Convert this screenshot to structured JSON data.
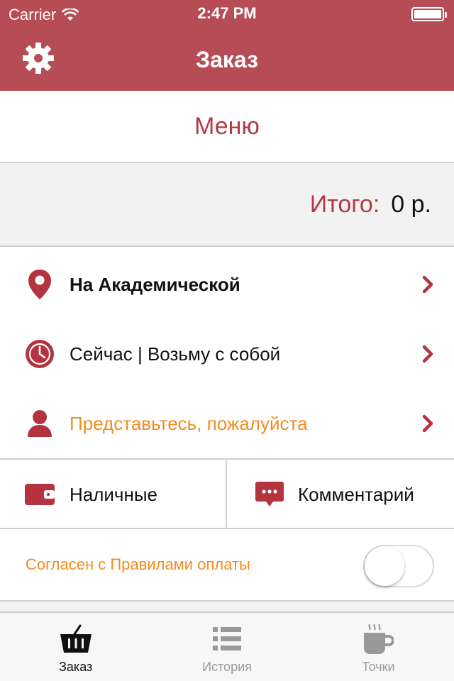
{
  "status_bar": {
    "carrier": "Carrier",
    "time": "2:47 PM"
  },
  "nav": {
    "title": "Заказ",
    "left_icon": "gear-icon"
  },
  "menu": {
    "label": "Меню"
  },
  "total": {
    "label": "Итого:",
    "value": "0 р."
  },
  "info_rows": [
    {
      "icon": "location-pin-icon",
      "text": "На Академической"
    },
    {
      "icon": "clock-icon",
      "text": "Сейчас | Возьму с собой"
    },
    {
      "icon": "person-icon",
      "text": "Представьтесь, пожалуйста"
    }
  ],
  "payment": {
    "icon": "wallet-icon",
    "text": "Наличные"
  },
  "comment": {
    "icon": "chat-bubble-icon",
    "text": "Комментарий"
  },
  "agreement": {
    "text": "Согласен с Правилами оплаты",
    "toggle_on": false
  },
  "tabs": [
    {
      "label": "Заказ",
      "icon": "basket-icon",
      "active": true
    },
    {
      "label": "История",
      "icon": "list-icon",
      "active": false
    },
    {
      "label": "Точки",
      "icon": "coffee-cup-icon",
      "active": false
    }
  ],
  "colors": {
    "brand": "#b64c56",
    "accent_red": "#b23a46",
    "orange": "#f28c1e",
    "icon_red": "#b5333f"
  }
}
